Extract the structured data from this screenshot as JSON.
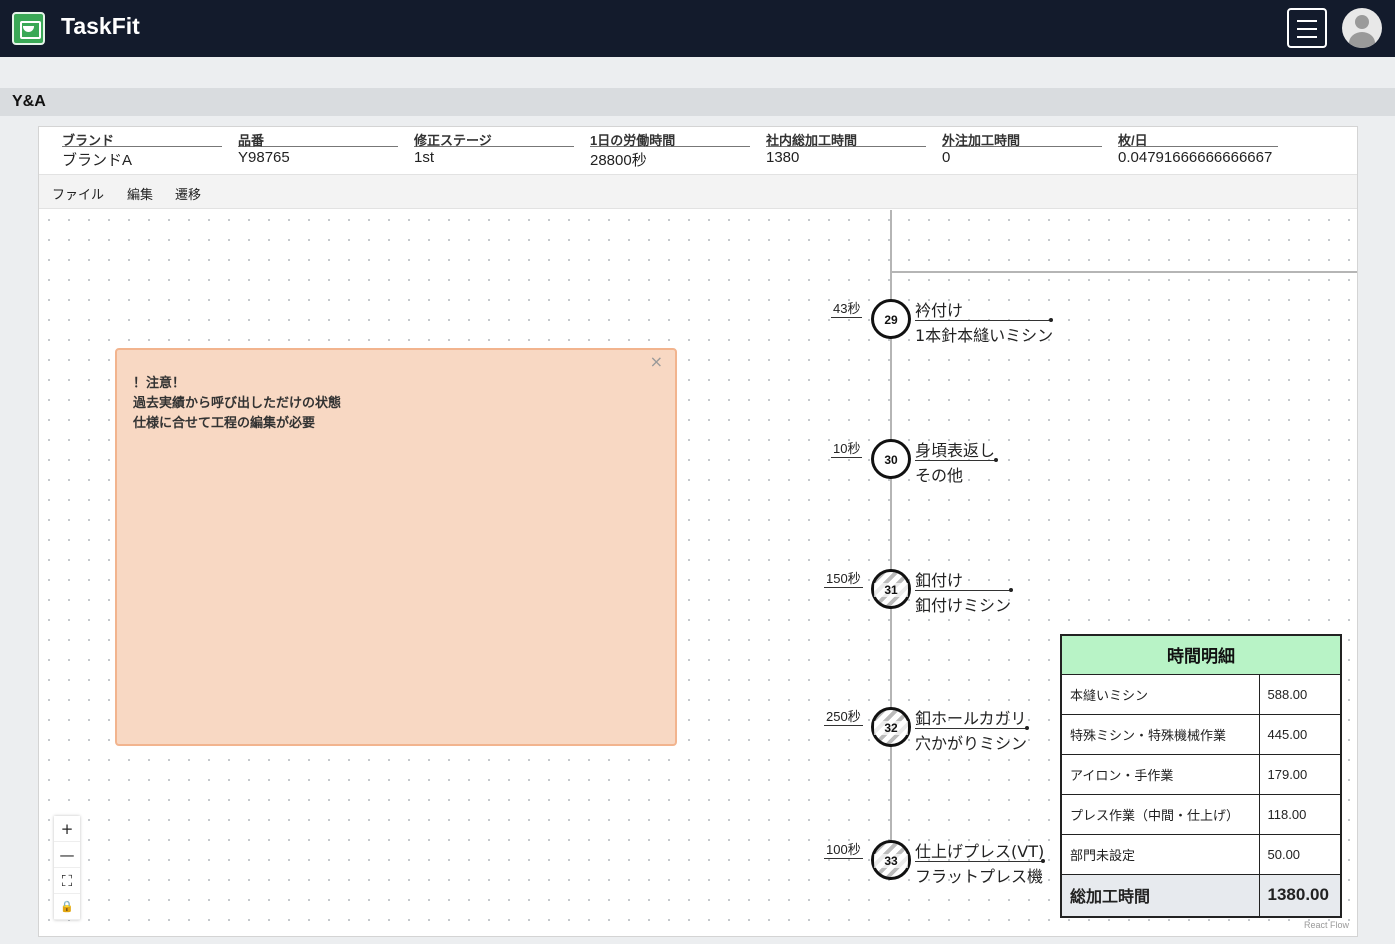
{
  "app": {
    "title": "TaskFit"
  },
  "page": {
    "title": "Y&A"
  },
  "info": [
    {
      "label": "ブランド",
      "value": "ブランドA"
    },
    {
      "label": "品番",
      "value": "Y98765"
    },
    {
      "label": "修正ステージ",
      "value": "1st"
    },
    {
      "label": "1日の労働時間",
      "value": "28800秒"
    },
    {
      "label": "社内総加工時間",
      "value": "1380"
    },
    {
      "label": "外注加工時間",
      "value": "0"
    },
    {
      "label": "枚/日",
      "value": "0.04791666666666667"
    }
  ],
  "menu": {
    "file": "ファイル",
    "edit": "編集",
    "transition": "遷移"
  },
  "note": {
    "close": "×",
    "lines": [
      "！注意！",
      "過去実績から呼び出しただけの状態",
      "仕様に合せて工程の編集が必要"
    ]
  },
  "nodes": [
    {
      "number": "29",
      "time": "43秒",
      "name": "衿付け",
      "machine": "1本針本縫いミシン",
      "hatched": false
    },
    {
      "number": "30",
      "time": "10秒",
      "name": "身頃表返し",
      "machine": "その他",
      "hatched": false
    },
    {
      "number": "31",
      "time": "150秒",
      "name": "釦付け",
      "machine": "釦付けミシン",
      "hatched": true
    },
    {
      "number": "32",
      "time": "250秒",
      "name": "釦ホールカガリ",
      "machine": "穴かがりミシン",
      "hatched": true
    },
    {
      "number": "33",
      "time": "100秒",
      "name": "仕上げプレス(VT)",
      "machine": "フラットプレス機",
      "hatched": true
    }
  ],
  "controls": {
    "zoom_in": "+",
    "zoom_out": "—",
    "fit_view": "⛶",
    "lock": "🔒"
  },
  "time_table": {
    "title": "時間明細",
    "rows": [
      {
        "label": "本縫いミシン",
        "value": "588.00"
      },
      {
        "label": "特殊ミシン・特殊機械作業",
        "value": "445.00"
      },
      {
        "label": "アイロン・手作業",
        "value": "179.00"
      },
      {
        "label": "プレス作業（中間・仕上げ）",
        "value": "118.00"
      },
      {
        "label": "部門未設定",
        "value": "50.00"
      }
    ],
    "total_label": "総加工時間",
    "total_value": "1380.00"
  },
  "attribution": "React Flow"
}
